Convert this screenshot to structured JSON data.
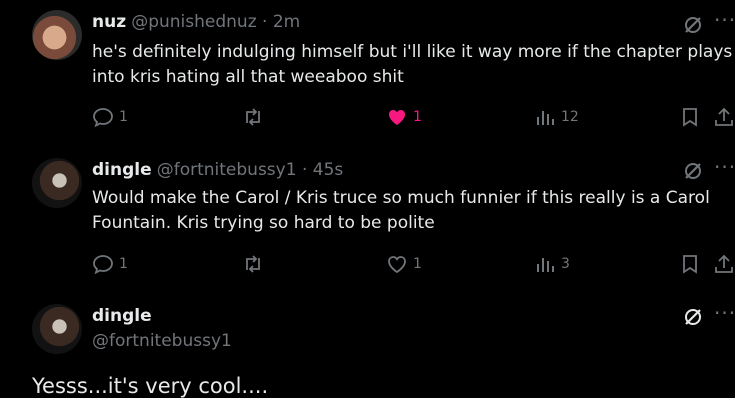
{
  "posts": [
    {
      "name": "nuz",
      "handle_time": "@punishednuz · 2m",
      "text_line1": "he's definitely indulging himself but i'll like it way more if the chapter plays",
      "text_line2": "into kris hating all that weeaboo shit",
      "replies": "1",
      "likes": "1",
      "views": "12",
      "liked": true
    },
    {
      "name": "dingle",
      "handle_time": "@fortnitebussy1 · 45s",
      "text_line1": "Would make the Carol / Kris truce so much funnier if this really is a Carol",
      "text_line2": "Fountain. Kris trying so hard to be polite",
      "replies": "1",
      "likes": "1",
      "views": "3",
      "liked": false
    }
  ],
  "compose": {
    "name": "dingle",
    "handle": "@fortnitebussy1",
    "text": "Yesss...it's very cool...."
  },
  "colors": {
    "like": "#f91880",
    "muted": "#71767b"
  },
  "icons": [
    "reply-icon",
    "retweet-icon",
    "heart-icon",
    "views-icon",
    "bookmark-icon",
    "share-icon",
    "grok-icon",
    "more-icon"
  ]
}
